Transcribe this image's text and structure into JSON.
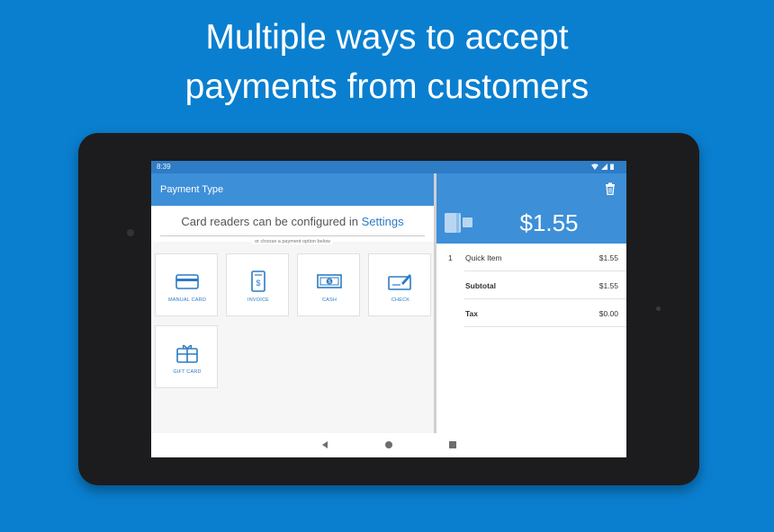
{
  "headline": {
    "line1": "Multiple ways to accept",
    "line2": "payments from customers"
  },
  "status_bar": {
    "time": "8:39",
    "icons": [
      "wifi-icon",
      "signal-icon",
      "battery-icon"
    ]
  },
  "left_pane": {
    "title": "Payment Type",
    "config_note_prefix": "Card readers can be configured in ",
    "config_note_link": "Settings",
    "divider_text": "or choose a payment option below",
    "options": [
      {
        "label": "MANUAL CARD",
        "icon": "credit-card-icon"
      },
      {
        "label": "INVOICE",
        "icon": "invoice-icon"
      },
      {
        "label": "CASH",
        "icon": "cash-icon"
      },
      {
        "label": "CHECK",
        "icon": "check-icon"
      },
      {
        "label": "GIFT CARD",
        "icon": "gift-card-icon"
      }
    ]
  },
  "right_pane": {
    "total": "$1.55",
    "items": [
      {
        "qty": "1",
        "name": "Quick Item",
        "amount": "$1.55"
      }
    ],
    "summary": [
      {
        "label": "Subtotal",
        "amount": "$1.55"
      },
      {
        "label": "Tax",
        "amount": "$0.00"
      }
    ]
  },
  "colors": {
    "background": "#0a7fd0",
    "app_bar": "#3d8fd8",
    "status_bar": "#2e7cc6",
    "accent": "#2b7bc4"
  },
  "nav_bar": {
    "buttons": [
      "back-icon",
      "home-icon",
      "recents-icon"
    ]
  }
}
